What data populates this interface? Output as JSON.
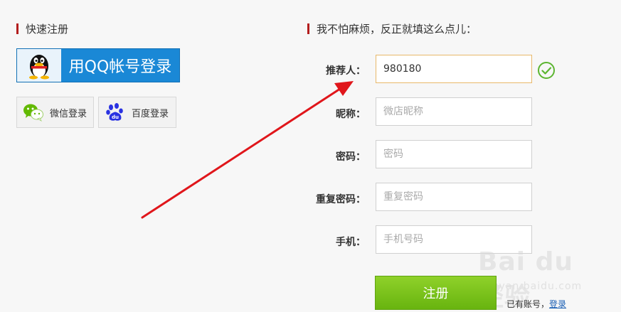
{
  "left_section": {
    "title": "快速注册",
    "qq_login_label": "用QQ帐号登录",
    "wechat_login_label": "微信登录",
    "baidu_login_label": "百度登录"
  },
  "right_section": {
    "title": "我不怕麻烦，反正就填这么点儿："
  },
  "form": {
    "referrer_label": "推荐人：",
    "referrer_value": "980180",
    "nickname_label": "昵称：",
    "nickname_placeholder": "微店昵称",
    "password_label": "密码：",
    "password_placeholder": "密码",
    "confirm_password_label": "重复密码：",
    "confirm_password_placeholder": "重复密码",
    "phone_label": "手机：",
    "phone_placeholder": "手机号码",
    "register_label": "注册",
    "have_account_text": "已有账号，",
    "login_link": "登录"
  },
  "watermark": {
    "main": "Bai du 经验",
    "sub": "jingyan.baidu.com"
  },
  "colors": {
    "accent_bar": "#b31d1d",
    "qq_blue": "#1a88d6",
    "register_green": "#7cc21d",
    "arrow_red": "#e0161b",
    "check_green": "#5cb531"
  },
  "icons": {
    "qq": "qq-penguin-icon",
    "wechat": "wechat-icon",
    "baidu": "baidu-paw-icon",
    "valid": "check-circle-icon"
  }
}
